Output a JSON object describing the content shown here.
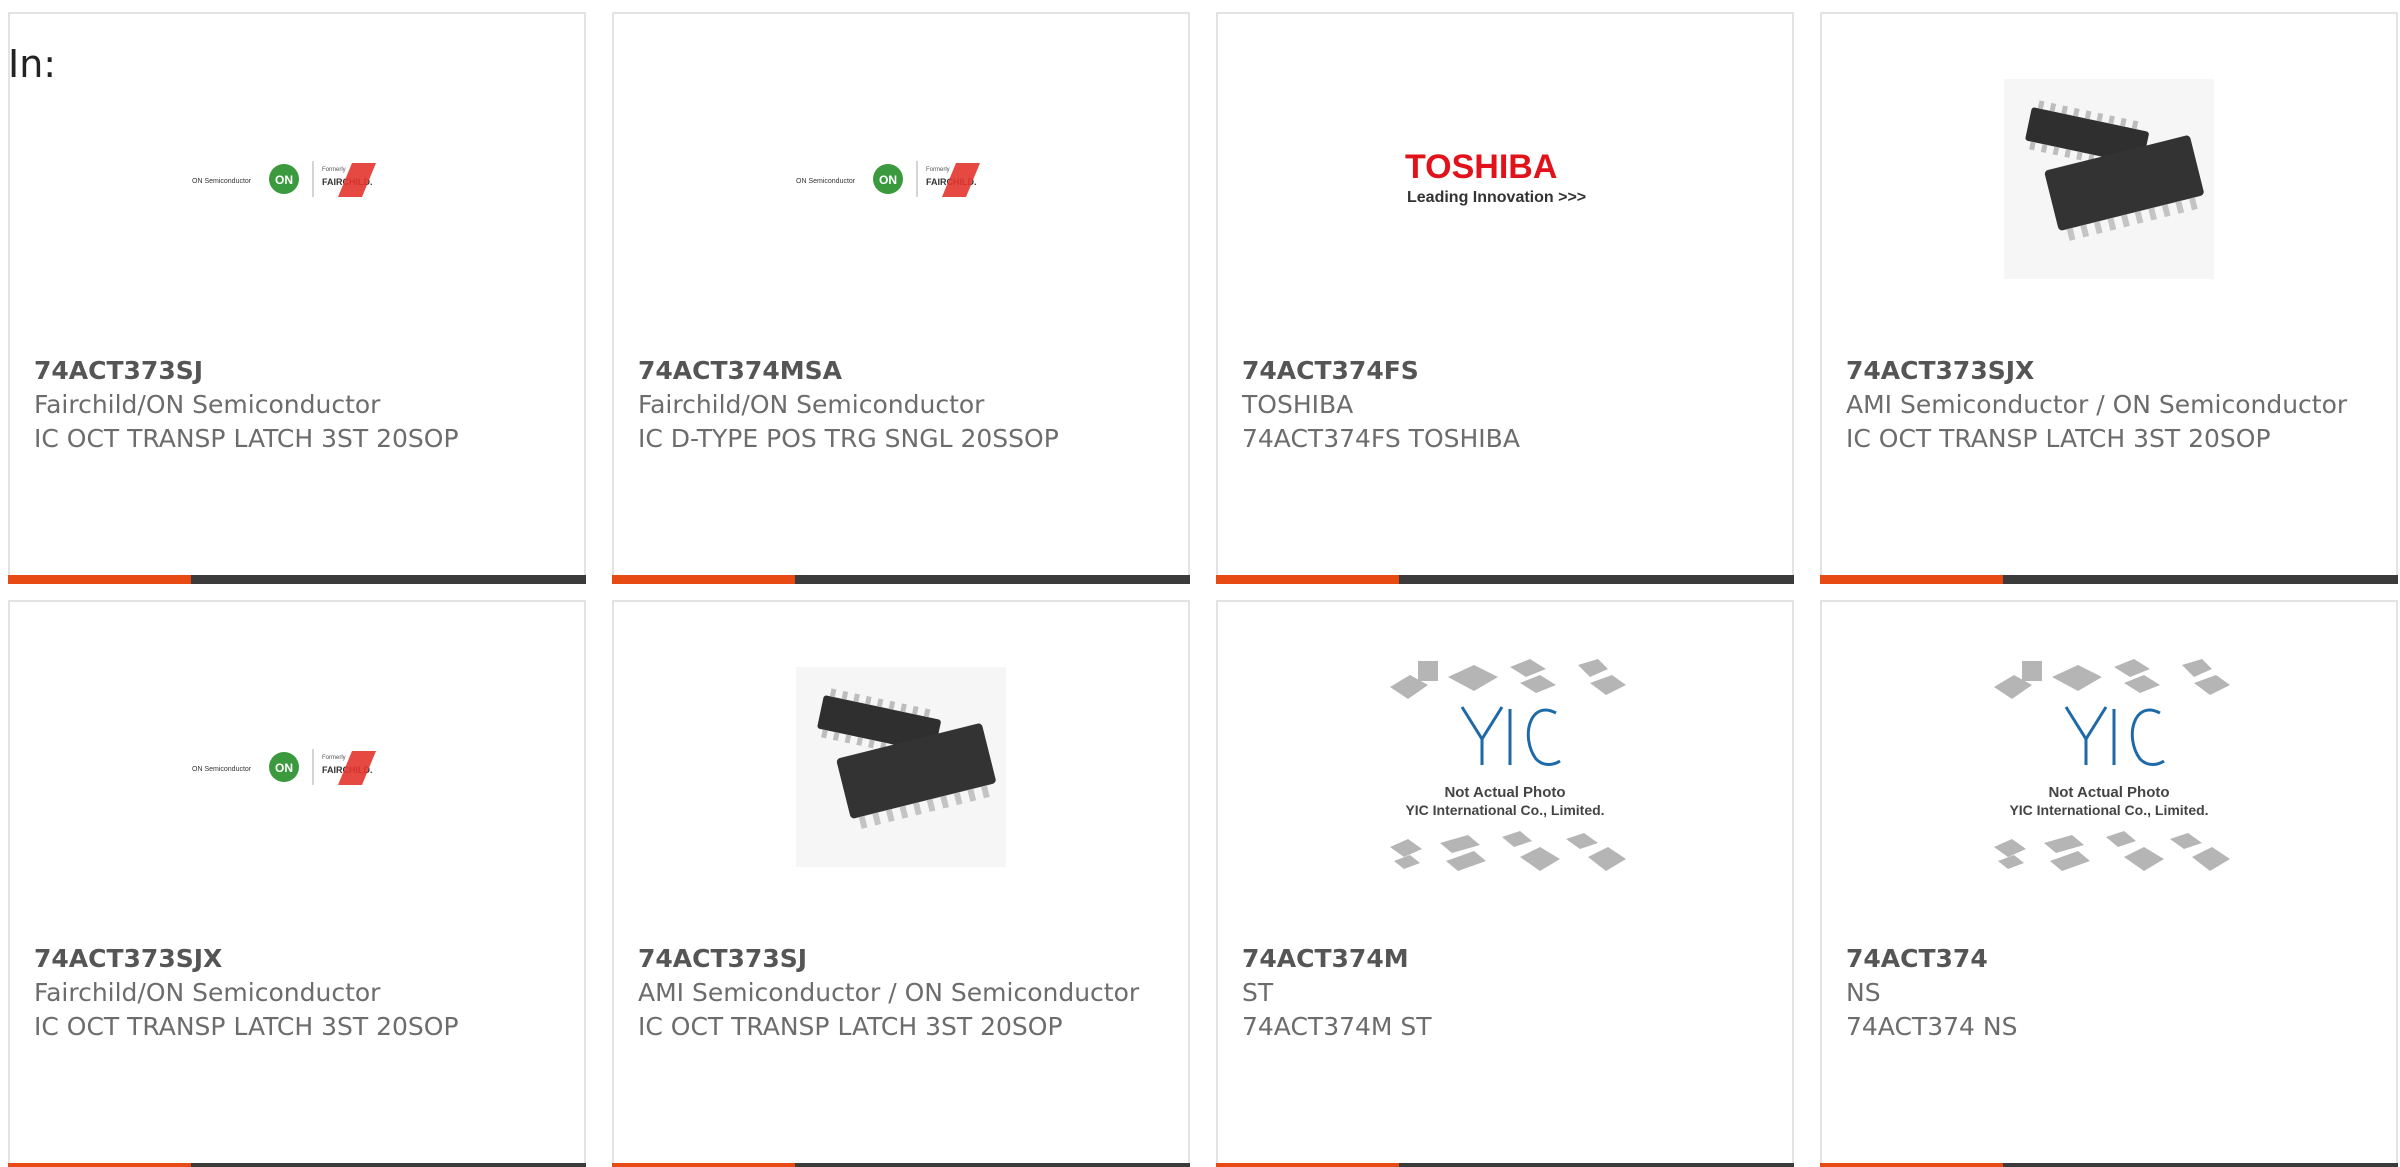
{
  "filter": {
    "label": "In:"
  },
  "colors": {
    "accent_bar": "#e84a13",
    "dark_bar": "#3b3b3b",
    "onsemi_green": "#3c9a3e",
    "fairchild_red": "#e2352c",
    "toshiba_red": "#e1121a",
    "yic_blue": "#1e6aa8"
  },
  "logos": {
    "onsemi": {
      "brand": "ON Semiconductor",
      "mark": "ON",
      "formerly": "Formerly",
      "fairchild": "FAIRCHILD."
    },
    "toshiba": {
      "brand": "TOSHIBA",
      "tagline": "Leading Innovation >>>"
    },
    "placeholder": {
      "mark": "YIC",
      "line1": "Not Actual Photo",
      "line2": "YIC International Co., Limited."
    }
  },
  "products": [
    {
      "part": "74ACT373SJ",
      "mfr": "Fairchild/ON Semiconductor",
      "desc": "IC OCT TRANSP LATCH 3ST 20SOP",
      "image": "onsemi-fairchild-logo"
    },
    {
      "part": "74ACT374MSA",
      "mfr": "Fairchild/ON Semiconductor",
      "desc": "IC D-TYPE POS TRG SNGL 20SSOP",
      "image": "onsemi-fairchild-logo"
    },
    {
      "part": "74ACT374FS",
      "mfr": "TOSHIBA",
      "desc": "74ACT374FS TOSHIBA",
      "image": "toshiba-logo"
    },
    {
      "part": "74ACT373SJX",
      "mfr": "AMI Semiconductor / ON Semiconductor",
      "desc": "IC OCT TRANSP LATCH 3ST 20SOP",
      "image": "soic-chip-photo"
    },
    {
      "part": "74ACT373SJX",
      "mfr": "Fairchild/ON Semiconductor",
      "desc": "IC OCT TRANSP LATCH 3ST 20SOP",
      "image": "onsemi-fairchild-logo"
    },
    {
      "part": "74ACT373SJ",
      "mfr": "AMI Semiconductor / ON Semiconductor",
      "desc": "IC OCT TRANSP LATCH 3ST 20SOP",
      "image": "soic-chip-photo"
    },
    {
      "part": "74ACT374M",
      "mfr": "ST",
      "desc": "74ACT374M ST",
      "image": "yic-placeholder"
    },
    {
      "part": "74ACT374",
      "mfr": "NS",
      "desc": "74ACT374 NS",
      "image": "yic-placeholder"
    }
  ]
}
